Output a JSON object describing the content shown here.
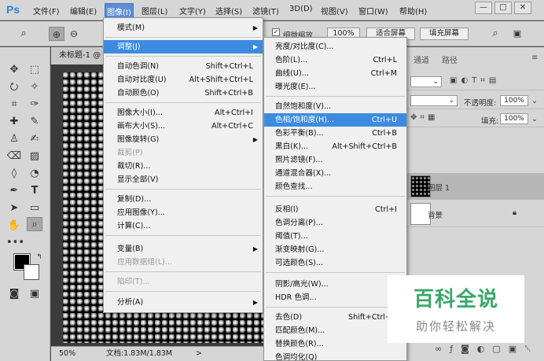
{
  "app": {
    "logo": "Ps",
    "window_controls": [
      "—",
      "□",
      "✕"
    ]
  },
  "menubar": {
    "items": [
      "文件(F)",
      "编辑(E)",
      "图像(I)",
      "图层(L)",
      "文字(Y)",
      "选择(S)",
      "滤镜(T)",
      "3D(D)",
      "视图(V)",
      "窗口(W)",
      "帮助(H)"
    ]
  },
  "options_bar": {
    "zoom_fit_label": "细微缩放",
    "zoom_value": "100%",
    "fit_screen": "适合屏幕",
    "fill_screen": "填充屏幕"
  },
  "document": {
    "tab_title": "未标题-1 @",
    "zoom": "50%",
    "status": "文档:1.83M/1.83M",
    "status_arrow": ">"
  },
  "image_menu": {
    "items": [
      {
        "label": "模式(M)",
        "submenu": true
      },
      {
        "label": "调整(J)",
        "submenu": true,
        "highlight": true
      },
      {
        "label": "自动色调(N)",
        "shortcut": "Shift+Ctrl+L"
      },
      {
        "label": "自动对比度(U)",
        "shortcut": "Alt+Shift+Ctrl+L"
      },
      {
        "label": "自动颜色(O)",
        "shortcut": "Shift+Ctrl+B"
      },
      {
        "label": "图像大小(I)...",
        "shortcut": "Alt+Ctrl+I"
      },
      {
        "label": "画布大小(S)...",
        "shortcut": "Alt+Ctrl+C"
      },
      {
        "label": "图像旋转(G)",
        "submenu": true
      },
      {
        "label": "裁剪(P)",
        "disabled": true
      },
      {
        "label": "裁切(R)..."
      },
      {
        "label": "显示全部(V)"
      },
      {
        "label": "复制(D)..."
      },
      {
        "label": "应用图像(Y)..."
      },
      {
        "label": "计算(C)..."
      },
      {
        "label": "变量(B)",
        "submenu": true
      },
      {
        "label": "应用数据组(L)...",
        "disabled": true
      },
      {
        "label": "陷印(T)...",
        "disabled": true
      },
      {
        "label": "分析(A)",
        "submenu": true
      }
    ]
  },
  "adjust_menu": {
    "items": [
      {
        "label": "亮度/对比度(C)..."
      },
      {
        "label": "色阶(L)...",
        "shortcut": "Ctrl+L"
      },
      {
        "label": "曲线(U)...",
        "shortcut": "Ctrl+M"
      },
      {
        "label": "曝光度(E)..."
      },
      {
        "label": "自然饱和度(V)..."
      },
      {
        "label": "色相/饱和度(H)...",
        "shortcut": "Ctrl+U",
        "highlight": true
      },
      {
        "label": "色彩平衡(B)...",
        "shortcut": "Ctrl+B"
      },
      {
        "label": "黑白(K)...",
        "shortcut": "Alt+Shift+Ctrl+B"
      },
      {
        "label": "照片滤镜(F)..."
      },
      {
        "label": "通道混合器(X)..."
      },
      {
        "label": "颜色查找..."
      },
      {
        "label": "反相(I)",
        "shortcut": "Ctrl+I"
      },
      {
        "label": "色调分离(P)..."
      },
      {
        "label": "阈值(T)..."
      },
      {
        "label": "渐变映射(G)..."
      },
      {
        "label": "可选颜色(S)..."
      },
      {
        "label": "阴影/高光(W)..."
      },
      {
        "label": "HDR 色调..."
      },
      {
        "label": "去色(D)",
        "shortcut": "Shift+Ctrl+U"
      },
      {
        "label": "匹配颜色(M)..."
      },
      {
        "label": "替换颜色(R)..."
      },
      {
        "label": "色调均化(Q)"
      }
    ]
  },
  "right_panel": {
    "tabs": [
      "通道",
      "路径"
    ],
    "opacity_label": "不透明度:",
    "opacity_value": "100%",
    "fill_label": "填充:",
    "fill_value": "100%",
    "layers": [
      {
        "name": "图层 1"
      },
      {
        "name": "背景"
      }
    ]
  },
  "watermark": {
    "title": "百科全说",
    "subtitle": "助你轻松解决"
  }
}
